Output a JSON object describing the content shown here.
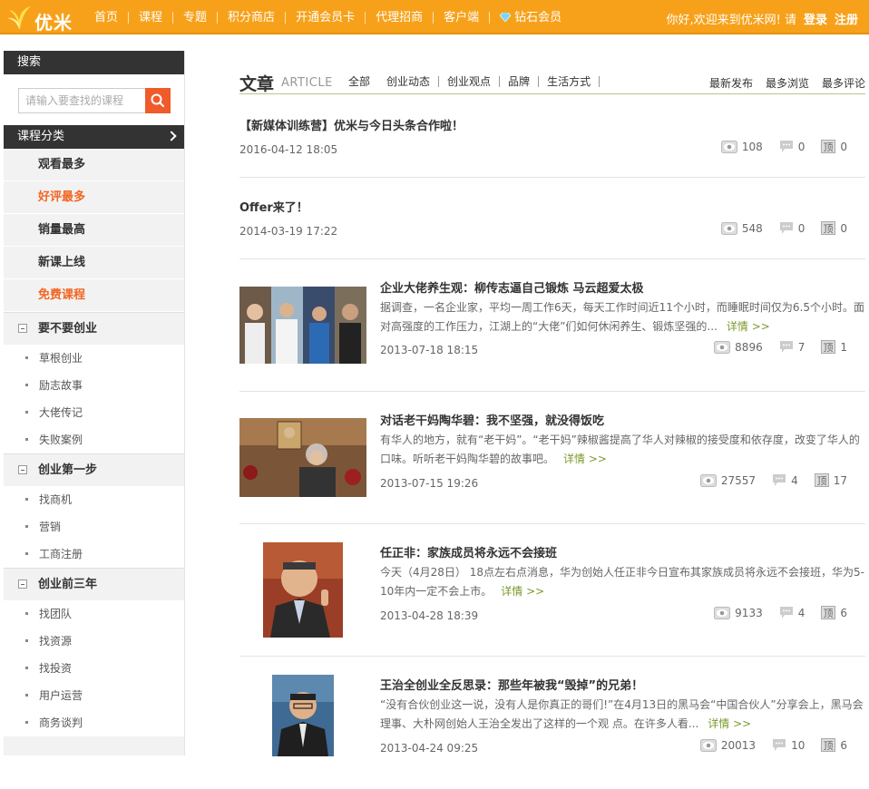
{
  "header": {
    "logo_text": "优米",
    "nav": [
      "首页",
      "课程",
      "专题",
      "积分商店",
      "开通会员卡",
      "代理招商",
      "客户端",
      "钻石会员"
    ],
    "welcome": "你好,欢迎来到优米网! 请",
    "login": "登录",
    "register": "注册",
    "accent_color": "#f7a11a"
  },
  "sidebar": {
    "search_title": "搜索",
    "search_placeholder": "请输入要查找的课程",
    "category_title": "课程分类",
    "categories": [
      "观看最多",
      "好评最多",
      "销量最高",
      "新课上线",
      "免费课程"
    ],
    "groups": [
      {
        "title": "要不要创业",
        "items": [
          "草根创业",
          "励志故事",
          "大佬传记",
          "失败案例"
        ]
      },
      {
        "title": "创业第一步",
        "items": [
          "找商机",
          "营销",
          "工商注册"
        ]
      },
      {
        "title": "创业前三年",
        "items": [
          "找团队",
          "找资源",
          "找投资",
          "用户运营",
          "商务谈判"
        ]
      }
    ]
  },
  "main": {
    "title": "文章",
    "title_en": "ARTICLE",
    "tabs": [
      "全部",
      "创业动态",
      "创业观点",
      "品牌",
      "生活方式"
    ],
    "sorts": [
      "最新发布",
      "最多浏览",
      "最多评论"
    ],
    "articles": [
      {
        "title": "【新媒体训练营】优米与今日头条合作啦！",
        "date": "2016-04-12 18:05",
        "views": "108",
        "comments": "0",
        "likes": "0"
      },
      {
        "title": "Offer来了！",
        "date": "2014-03-19 17:22",
        "views": "548",
        "comments": "0",
        "likes": "0"
      },
      {
        "title": "企业大佬养生观：柳传志逼自己锻炼 马云超爱太极",
        "desc": "据调查，一名企业家，平均一周工作6天，每天工作时间近11个小时，而睡眠时间仅为6.5个小时。面对高强度的工作压力，江湖上的“大佬”们如何休闲养生、锻炼坚强的...",
        "more": "详情 >>",
        "date": "2013-07-18 18:15",
        "views": "8896",
        "comments": "7",
        "likes": "1"
      },
      {
        "title": "对话老干妈陶华碧：我不坚强，就没得饭吃",
        "desc": "有华人的地方，就有“老干妈”。“老干妈”辣椒酱提高了华人对辣椒的接受度和依存度，改变了华人的口味。听听老干妈陶华碧的故事吧。",
        "more": "详情 >>",
        "date": "2013-07-15 19:26",
        "views": "27557",
        "comments": "4",
        "likes": "17"
      },
      {
        "title": "任正非：家族成员将永远不会接班",
        "desc": "今天（4月28日） 18点左右点消息，华为创始人任正非今日宣布其家族成员将永远不会接班，华为5-10年内一定不会上市。",
        "more": "详情 >>",
        "date": "2013-04-28 18:39",
        "views": "9133",
        "comments": "4",
        "likes": "6"
      },
      {
        "title": "王治全创业全反思录：那些年被我“毁掉”的兄弟！",
        "desc": "“没有合伙创业这一说，没有人是你真正的哥们!”在4月13日的黑马会“中国合伙人”分享会上，黑马会理事、大朴网创始人王治全发出了这样的一个观 点。在许多人看...",
        "more": "详情 >>",
        "date": "2013-04-24 09:25",
        "views": "20013",
        "comments": "10",
        "likes": "6"
      }
    ],
    "like_glyph": "顶"
  }
}
